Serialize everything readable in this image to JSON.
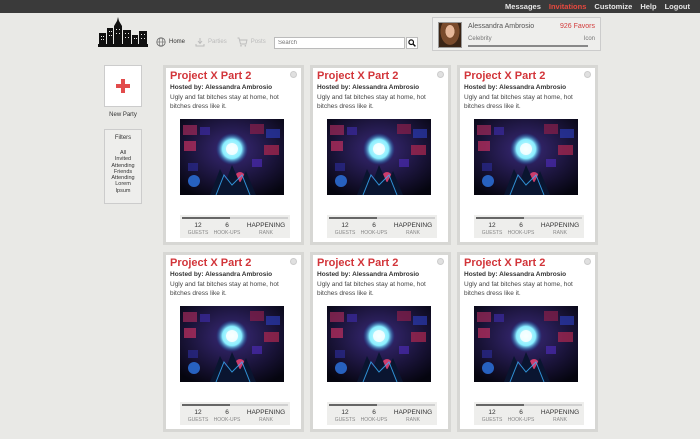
{
  "topnav": {
    "items": [
      {
        "label": "Messages",
        "active": false
      },
      {
        "label": "Invitations",
        "active": true
      },
      {
        "label": "Customize",
        "active": false
      },
      {
        "label": "Help",
        "active": false
      },
      {
        "label": "Logout",
        "active": false
      }
    ]
  },
  "nav": {
    "home": "Home",
    "parties": "Parties",
    "posts": "Posts",
    "search_placeholder": "Search"
  },
  "profile": {
    "name": "Alessandra Ambrosio",
    "favors": "926 Favors",
    "role": "Celebrity",
    "icon_label": "Icon"
  },
  "sidebar": {
    "new_party": "New Party",
    "filters_title": "Filters",
    "filters": [
      "All",
      "Invited",
      "Attending",
      "Friends",
      "Attending",
      "Lorem",
      "Ipsum"
    ]
  },
  "cards": [
    {
      "title": "Project X Part 2",
      "host": "Hosted by: Alessandra Ambrosio",
      "desc": "Ugly and fat bitches stay at home, hot bitches dress like it.",
      "guests": "12",
      "guests_label": "GUESTS",
      "hookups": "6",
      "hookups_label": "HOOK-UPS",
      "rank": "HAPPENING",
      "rank_label": "RANK",
      "progress": 0.45
    },
    {
      "title": "Project X Part 2",
      "host": "Hosted by: Alessandra Ambrosio",
      "desc": "Ugly and fat bitches stay at home, hot bitches dress like it.",
      "guests": "12",
      "guests_label": "GUESTS",
      "hookups": "6",
      "hookups_label": "HOOK-UPS",
      "rank": "HAPPENING",
      "rank_label": "RANK",
      "progress": 0.45
    },
    {
      "title": "Project X Part 2",
      "host": "Hosted by: Alessandra Ambrosio",
      "desc": "Ugly and fat bitches stay at home, hot bitches dress like it.",
      "guests": "12",
      "guests_label": "GUESTS",
      "hookups": "6",
      "hookups_label": "HOOK-UPS",
      "rank": "HAPPENING",
      "rank_label": "RANK",
      "progress": 0.45
    },
    {
      "title": "Project X Part 2",
      "host": "Hosted by: Alessandra Ambrosio",
      "desc": "Ugly and fat bitches stay at home, hot bitches dress like it.",
      "guests": "12",
      "guests_label": "GUESTS",
      "hookups": "6",
      "hookups_label": "HOOK-UPS",
      "rank": "HAPPENING",
      "rank_label": "RANK",
      "progress": 0.45
    },
    {
      "title": "Project X Part 2",
      "host": "Hosted by: Alessandra Ambrosio",
      "desc": "Ugly and fat bitches stay at home, hot bitches dress like it.",
      "guests": "12",
      "guests_label": "GUESTS",
      "hookups": "6",
      "hookups_label": "HOOK-UPS",
      "rank": "HAPPENING",
      "rank_label": "RANK",
      "progress": 0.45
    },
    {
      "title": "Project X Part 2",
      "host": "Hosted by: Alessandra Ambrosio",
      "desc": "Ugly and fat bitches stay at home, hot bitches dress like it.",
      "guests": "12",
      "guests_label": "GUESTS",
      "hookups": "6",
      "hookups_label": "HOOK-UPS",
      "rank": "HAPPENING",
      "rank_label": "RANK",
      "progress": 0.45
    }
  ],
  "colors": {
    "accent": "#d2353a",
    "topbar": "#3a3a3a",
    "active_nav": "#e8493f"
  }
}
